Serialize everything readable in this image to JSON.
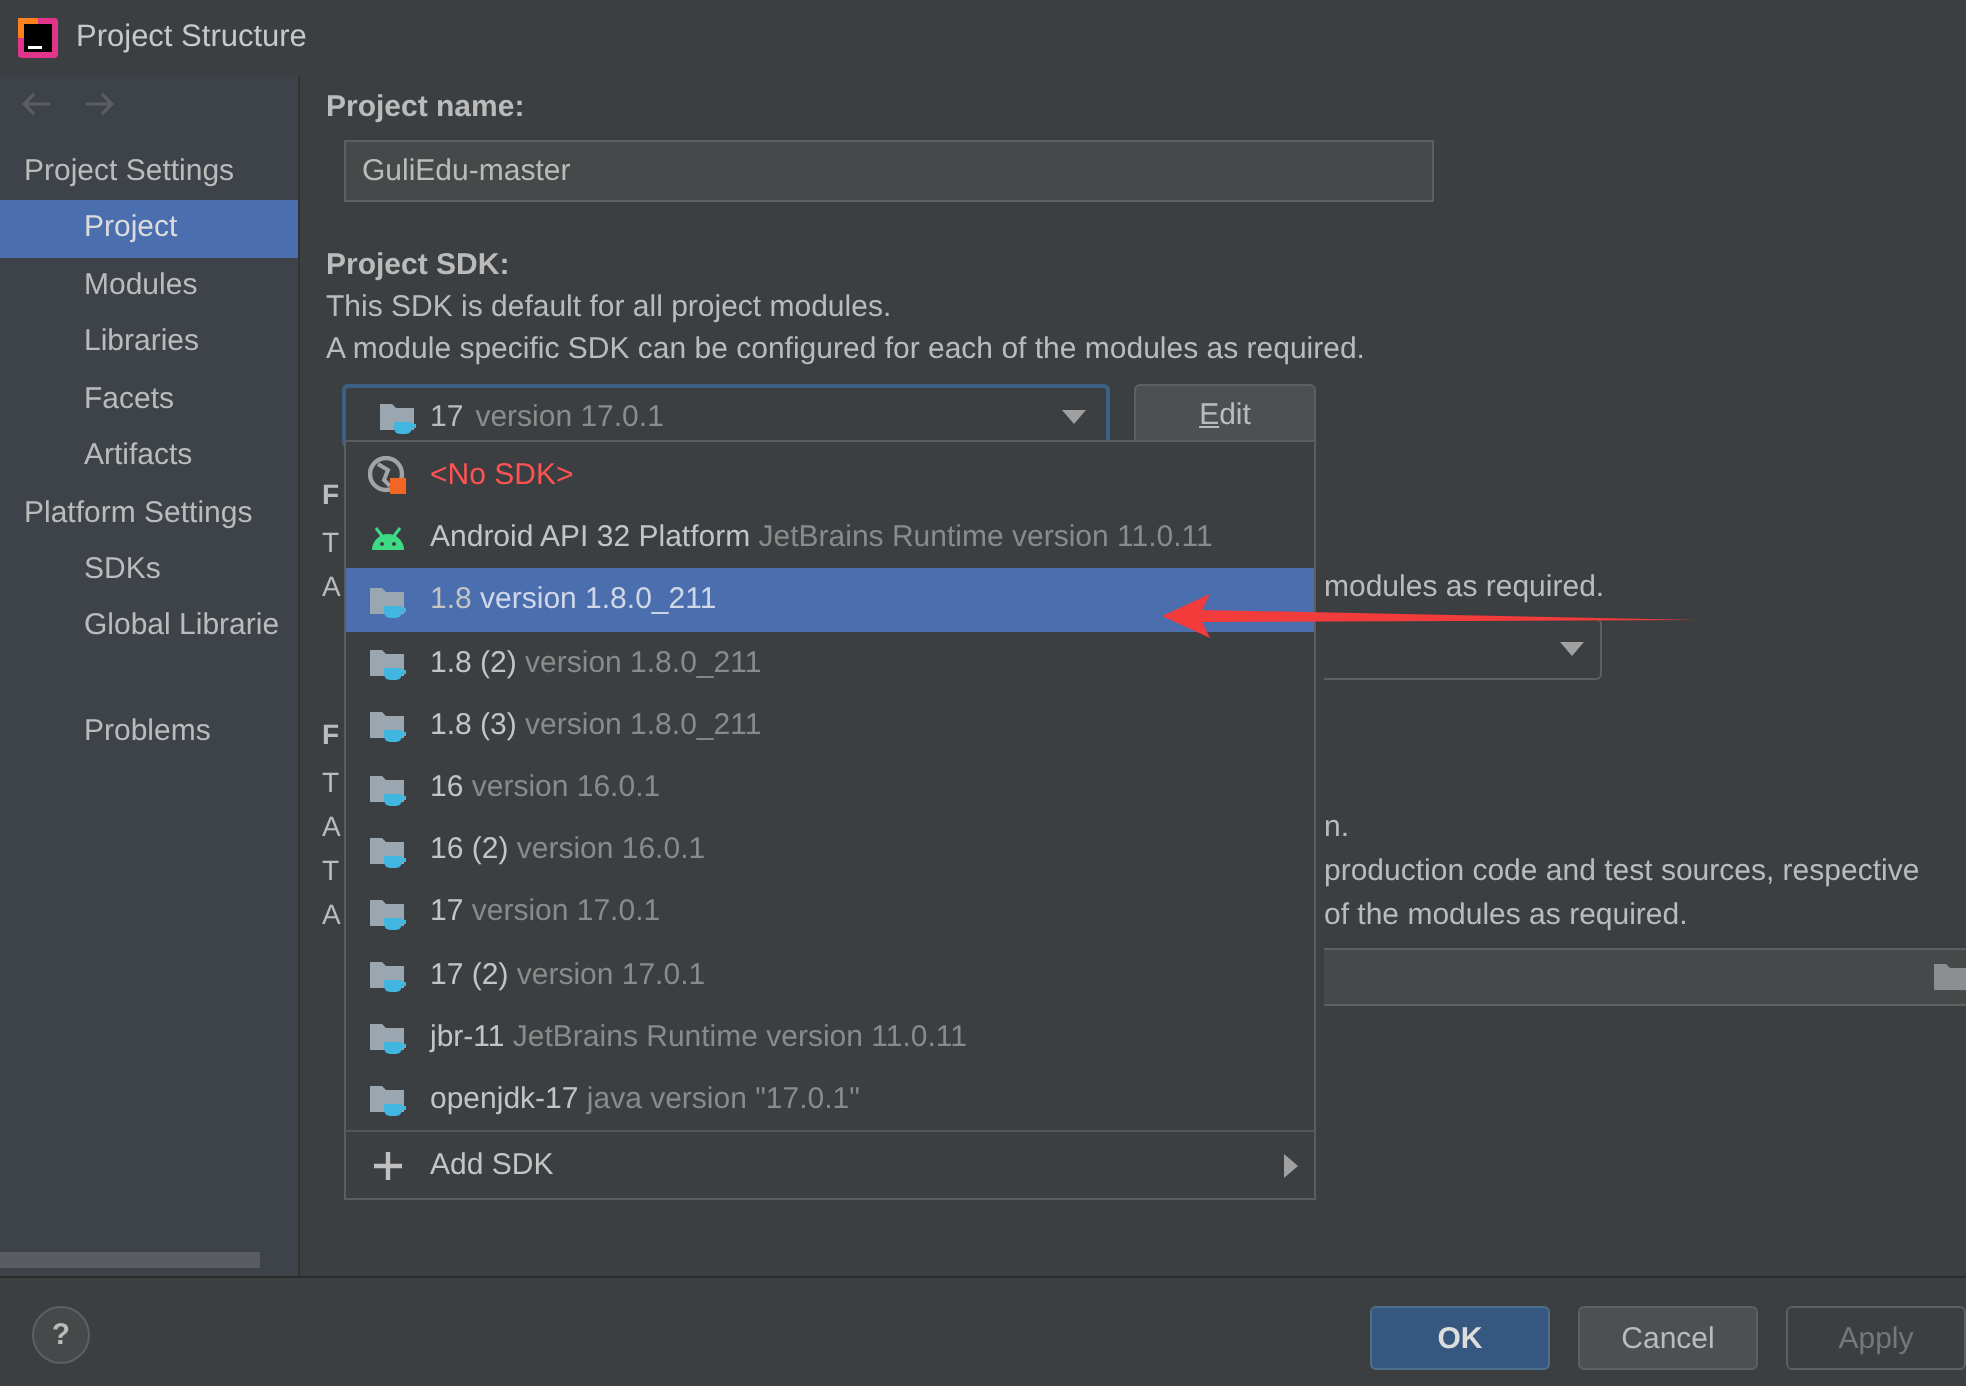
{
  "window": {
    "title": "Project Structure"
  },
  "sidebar": {
    "sections": [
      {
        "heading": "Project Settings",
        "items": [
          {
            "label": "Project",
            "selected": true
          },
          {
            "label": "Modules",
            "selected": false
          },
          {
            "label": "Libraries",
            "selected": false
          },
          {
            "label": "Facets",
            "selected": false
          },
          {
            "label": "Artifacts",
            "selected": false
          }
        ]
      },
      {
        "heading": "Platform Settings",
        "items": [
          {
            "label": "SDKs",
            "selected": false
          },
          {
            "label": "Global Librarie",
            "selected": false
          }
        ]
      }
    ],
    "extra_items": [
      {
        "label": "Problems",
        "selected": false
      }
    ]
  },
  "project_name": {
    "label": "Project name:",
    "value": "GuliEdu-master"
  },
  "project_sdk": {
    "label": "Project SDK:",
    "description": [
      "This SDK is default for all project modules.",
      "A module specific SDK can be configured for each of the modules as required."
    ],
    "selected_name": "17",
    "selected_detail": "version 17.0.1",
    "edit_button": "Edit"
  },
  "obscured_rows": [
    {
      "kind": "heading",
      "left": "F"
    },
    {
      "kind": "text",
      "left": "T"
    },
    {
      "kind": "text",
      "left": "A",
      "right": "modules as required."
    },
    {
      "kind": "dropdown"
    },
    {
      "kind": "gap"
    },
    {
      "kind": "heading",
      "left": "F"
    },
    {
      "kind": "text",
      "left": "T"
    },
    {
      "kind": "text",
      "left": "A",
      "right": "n."
    },
    {
      "kind": "text",
      "left": "T",
      "right": "production code and test sources, respective"
    },
    {
      "kind": "text",
      "left": "A",
      "right": "of the modules as required."
    },
    {
      "kind": "path_field"
    }
  ],
  "sdk_menu": {
    "items": [
      {
        "kind": "none",
        "name": "<No SDK>",
        "selected": false
      },
      {
        "kind": "android",
        "name": "Android API 32 Platform",
        "detail": "JetBrains Runtime version 11.0.11",
        "selected": false
      },
      {
        "kind": "jdk",
        "name": "1.8",
        "detail": "version 1.8.0_211",
        "selected": true
      },
      {
        "kind": "jdk",
        "name": "1.8 (2)",
        "detail": "version 1.8.0_211",
        "selected": false
      },
      {
        "kind": "jdk",
        "name": "1.8 (3)",
        "detail": "version 1.8.0_211",
        "selected": false
      },
      {
        "kind": "jdk",
        "name": "16",
        "detail": "version 16.0.1",
        "selected": false
      },
      {
        "kind": "jdk",
        "name": "16 (2)",
        "detail": "version 16.0.1",
        "selected": false
      },
      {
        "kind": "jdk",
        "name": "17",
        "detail": "version 17.0.1",
        "selected": false
      },
      {
        "kind": "jdk",
        "name": "17 (2)",
        "detail": "version 17.0.1",
        "selected": false
      },
      {
        "kind": "jdk",
        "name": "jbr-11",
        "detail": "JetBrains Runtime version 11.0.11",
        "selected": false
      },
      {
        "kind": "jdk",
        "name": "openjdk-17",
        "detail": "java version \"17.0.1\"",
        "selected": false
      },
      {
        "kind": "add",
        "name": "Add SDK",
        "selected": false
      }
    ]
  },
  "footer": {
    "help": "?",
    "buttons": [
      {
        "label": "OK",
        "default": true,
        "disabled": false
      },
      {
        "label": "Cancel",
        "default": false,
        "disabled": false
      },
      {
        "label": "Apply",
        "default": false,
        "disabled": true
      }
    ]
  }
}
